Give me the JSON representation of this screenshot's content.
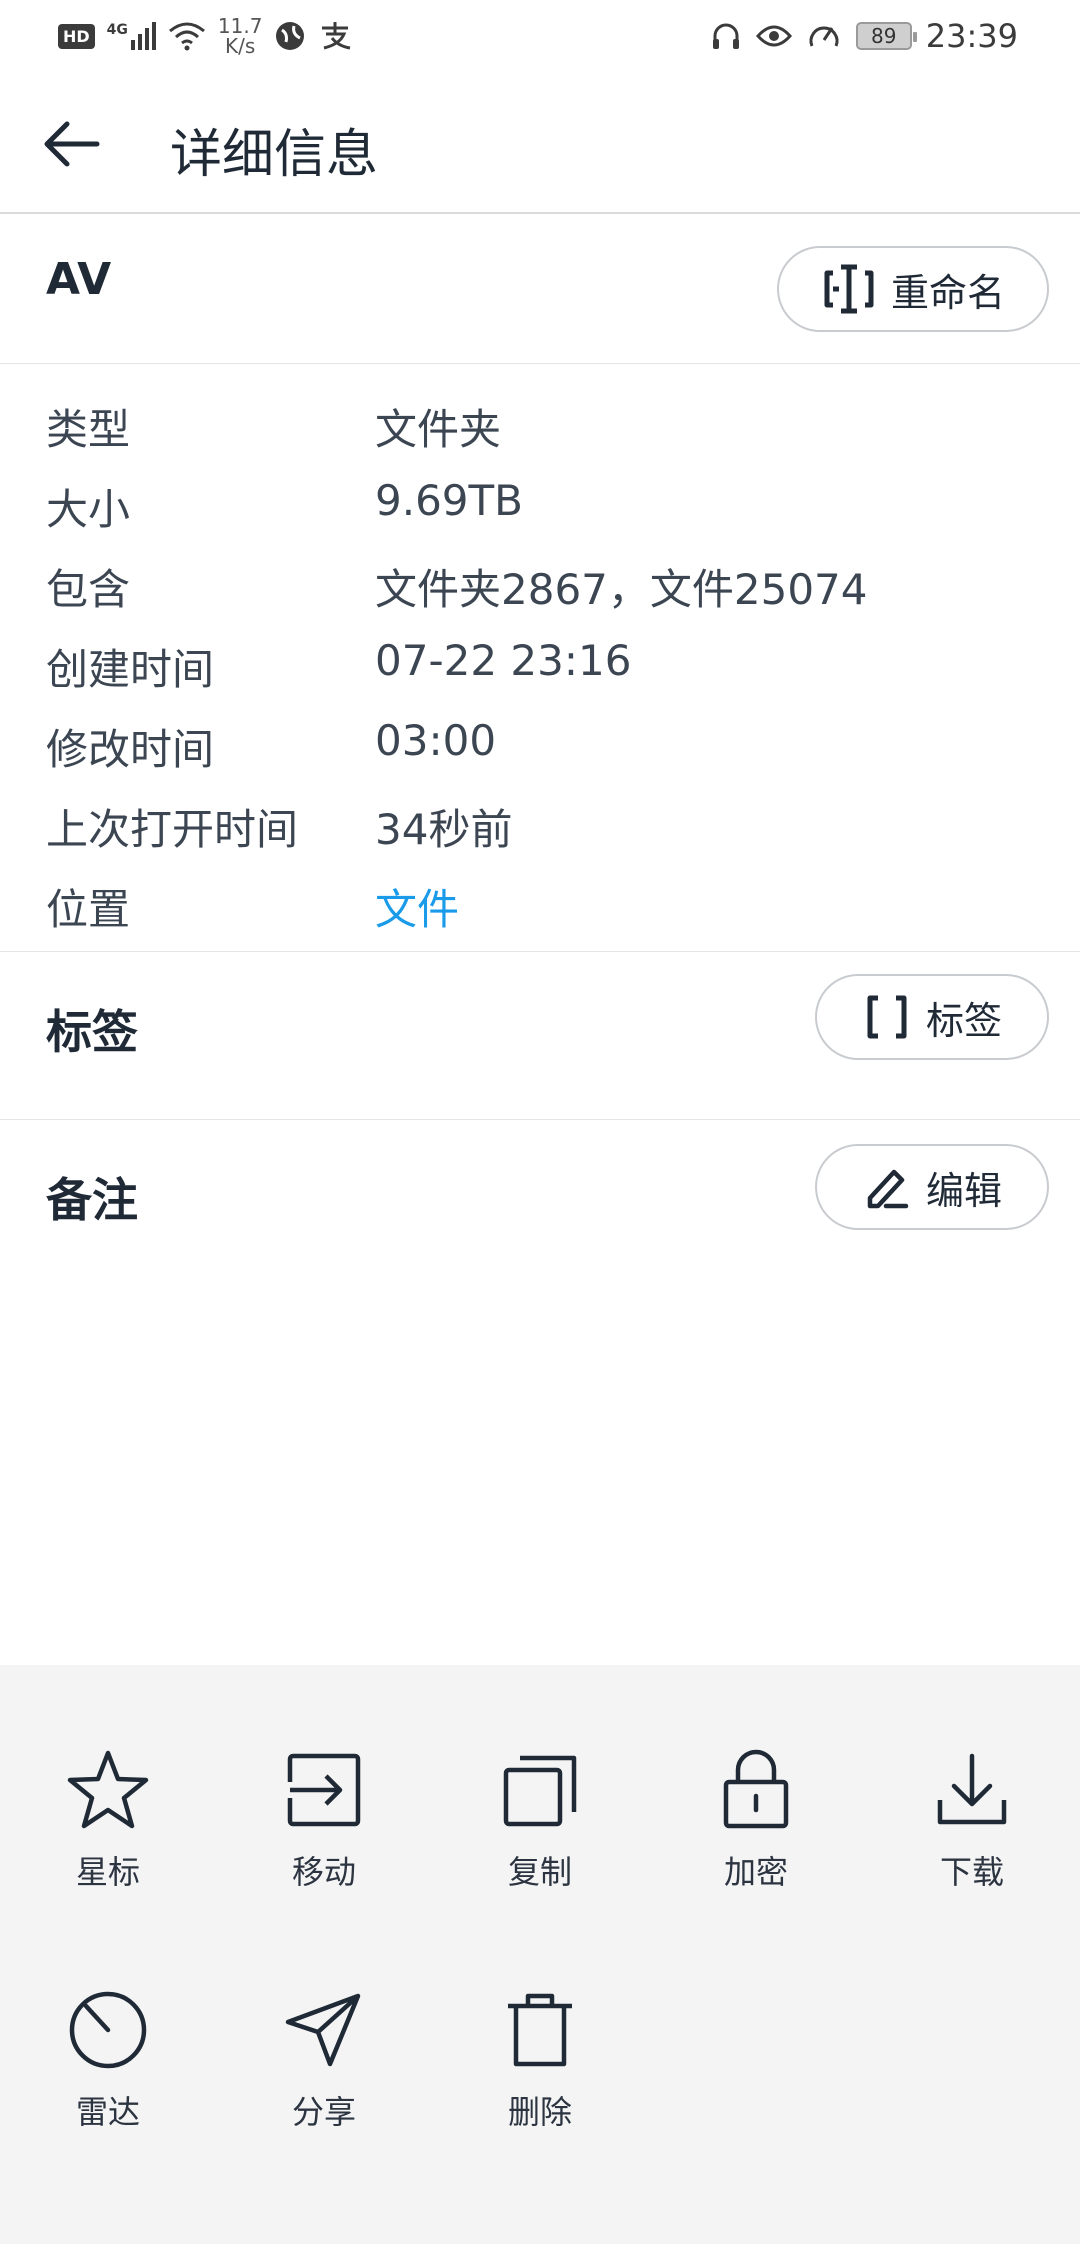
{
  "status_bar": {
    "hd": "HD",
    "network": "4G",
    "speed_value": "11.7",
    "speed_unit": "K/s",
    "battery": "89",
    "time": "23:39"
  },
  "header": {
    "title": "详细信息"
  },
  "item": {
    "name": "AV",
    "rename_label": "重命名"
  },
  "info": [
    {
      "label": "类型",
      "value": "文件夹"
    },
    {
      "label": "大小",
      "value": "9.69TB"
    },
    {
      "label": "包含",
      "value": "文件夹2867，文件25074"
    },
    {
      "label": "创建时间",
      "value": "07-22 23:16"
    },
    {
      "label": "修改时间",
      "value": "03:00"
    },
    {
      "label": "上次打开时间",
      "value": "34秒前"
    },
    {
      "label": "位置",
      "value": "文件"
    }
  ],
  "tags": {
    "title": "标签",
    "button_label": "标签"
  },
  "notes": {
    "title": "备注",
    "button_label": "编辑"
  },
  "actions": [
    {
      "label": "星标",
      "icon": "star-icon"
    },
    {
      "label": "移动",
      "icon": "move-icon"
    },
    {
      "label": "复制",
      "icon": "copy-icon"
    },
    {
      "label": "加密",
      "icon": "lock-icon"
    },
    {
      "label": "下载",
      "icon": "download-icon"
    },
    {
      "label": "雷达",
      "icon": "radar-icon"
    },
    {
      "label": "分享",
      "icon": "share-icon"
    },
    {
      "label": "删除",
      "icon": "trash-icon"
    }
  ],
  "colors": {
    "link": "#1a9bea",
    "text_primary": "#1f2a36",
    "panel_bg": "#f4f4f4"
  }
}
